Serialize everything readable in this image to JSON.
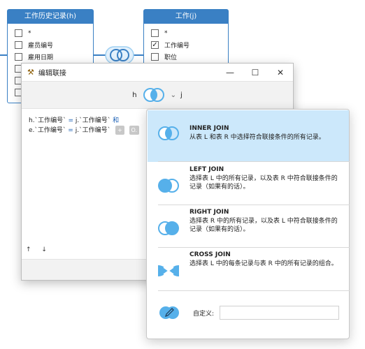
{
  "table_left": {
    "title": "工作历史记录(h)",
    "columns": [
      {
        "label": "*",
        "checked": false
      },
      {
        "label": "雇员编号",
        "checked": false
      },
      {
        "label": "雇用日期",
        "checked": false
      },
      {
        "label": "",
        "checked": false
      },
      {
        "label": "",
        "checked": false
      },
      {
        "label": "",
        "checked": false
      }
    ]
  },
  "table_right": {
    "title": "工作(j)",
    "columns": [
      {
        "label": "*",
        "checked": false
      },
      {
        "label": "工作编号",
        "checked": true
      },
      {
        "label": "职位",
        "checked": false
      }
    ]
  },
  "dialog": {
    "title": "编辑联接",
    "left_alias": "h",
    "right_alias": "j",
    "dropdown_glyph": "⌄",
    "conditions": [
      {
        "left": "h.`工作编号`",
        "op": "=",
        "right": "j.`工作编号`",
        "conj": "和"
      },
      {
        "left": "e.`工作编号`",
        "op": "=",
        "right": "j.`工作编号`",
        "conj": ""
      }
    ],
    "chip_add": "+",
    "chip_o": "O.",
    "move_up": "↑",
    "move_down": "↓"
  },
  "join_menu": {
    "options": [
      {
        "name": "INNER JOIN",
        "desc": "从表 L 和表 R 中选择符合联接条件的所有记录。",
        "selected": true
      },
      {
        "name": "LEFT JOIN",
        "desc": "选择表 L 中的所有记录，以及表 R 中符合联接条件的记录（如果有的话）。",
        "selected": false
      },
      {
        "name": "RIGHT JOIN",
        "desc": "选择表 R 中的所有记录，以及表 L 中符合联接条件的记录（如果有的话）。",
        "selected": false
      },
      {
        "name": "CROSS JOIN",
        "desc": "选择表 L 中的每条记录与表 R 中的所有记录的组合。",
        "selected": false
      }
    ],
    "custom_label": "自定义:",
    "custom_value": ""
  },
  "colors": {
    "accent": "#3a80c4",
    "venn": "#56b0ea",
    "selected_bg": "#cce8fb"
  }
}
